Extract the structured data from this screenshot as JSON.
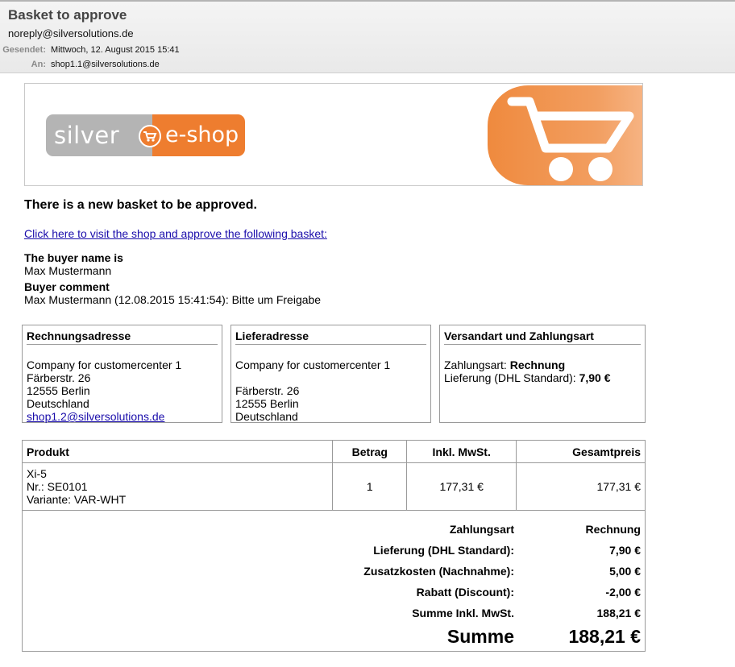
{
  "mail": {
    "subject": "Basket to approve",
    "sender": "noreply@silversolutions.de",
    "sent_label": "Gesendet:",
    "sent_value": "Mittwoch, 12. August 2015 15:41",
    "to_label": "An:",
    "to_value": "shop1.1@silversolutions.de"
  },
  "banner": {
    "logo_part1": "silver",
    "logo_part2": "e-shop",
    "colors": {
      "orange": "#ee7d2f",
      "grey": "#b4b4b4"
    }
  },
  "content": {
    "headline": "There is a new basket to be approved.",
    "link_text": "Click here to visit the shop and approve the following basket:",
    "buyer_label": "The buyer name is",
    "buyer_name": "Max Mustermann",
    "comment_label": "Buyer comment",
    "comment_text": "Max Mustermann (12.08.2015 15:41:54): Bitte um Freigabe"
  },
  "billing": {
    "title": "Rechnungsadresse",
    "company": "Company for customercenter 1",
    "street": "Färberstr. 26",
    "city": "12555 Berlin",
    "country": "Deutschland",
    "email": "shop1.2@silversolutions.de"
  },
  "delivery": {
    "title": "Lieferadresse",
    "company": "Company for customercenter 1",
    "street": "Färberstr. 26",
    "city": "12555 Berlin",
    "country": "Deutschland"
  },
  "shipping": {
    "title": "Versandart und Zahlungsart",
    "payment_label": "Zahlungsart:",
    "payment_value": "Rechnung",
    "delivery_label": "Lieferung (DHL Standard):",
    "delivery_value": "7,90 €"
  },
  "table": {
    "headers": {
      "product": "Produkt",
      "qty": "Betrag",
      "vat": "Inkl. MwSt.",
      "total": "Gesamtpreis"
    },
    "rows": [
      {
        "name": "Xi-5",
        "nr": "Nr.: SE0101",
        "variant": "Variante: VAR-WHT",
        "qty": "1",
        "price": "177,31 €",
        "total": "177,31 €"
      }
    ]
  },
  "summary": {
    "payment": {
      "label": "Zahlungsart",
      "value": "Rechnung"
    },
    "delivery": {
      "label": "Lieferung (DHL Standard):",
      "value": "7,90 €"
    },
    "extra": {
      "label": "Zusatzkosten (Nachnahme):",
      "value": "5,00 €"
    },
    "discount": {
      "label": "Rabatt (Discount):",
      "value": "-2,00 €"
    },
    "subtotal": {
      "label": "Summe Inkl. MwSt.",
      "value": "188,21 €"
    },
    "total": {
      "label": "Summe",
      "value": "188,21 €"
    }
  }
}
